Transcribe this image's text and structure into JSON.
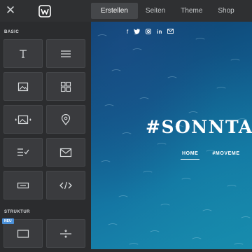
{
  "topbar": {
    "close_icon": "close-icon",
    "logo_icon": "weebly-w-icon",
    "tabs": [
      {
        "label": "Erstellen",
        "active": true
      },
      {
        "label": "Seiten",
        "active": false
      },
      {
        "label": "Theme",
        "active": false
      },
      {
        "label": "Shop",
        "active": false
      }
    ]
  },
  "sidebar": {
    "sections": {
      "basic": "BASIC",
      "struktur": "STRUKTUR"
    },
    "new_badge": "NEU",
    "elements": [
      {
        "icon": "title-icon"
      },
      {
        "icon": "text-icon"
      },
      {
        "icon": "image-icon"
      },
      {
        "icon": "gallery-icon"
      },
      {
        "icon": "slideshow-icon"
      },
      {
        "icon": "map-icon"
      },
      {
        "icon": "form-icon"
      },
      {
        "icon": "email-icon"
      },
      {
        "icon": "button-icon"
      },
      {
        "icon": "embed-code-icon"
      },
      {
        "icon": "section-icon"
      },
      {
        "icon": "divider-icon"
      }
    ]
  },
  "preview": {
    "social_icons": [
      {
        "glyph": "f",
        "name": "facebook-icon"
      },
      {
        "glyph": "🐦",
        "name": "twitter-icon"
      },
      {
        "glyph": "◎",
        "name": "instagram-icon"
      },
      {
        "glyph": "in",
        "name": "linkedin-icon"
      },
      {
        "glyph": "✉",
        "name": "mail-icon"
      }
    ],
    "title": "#SONNTAG",
    "nav": [
      {
        "label": "HOME",
        "active": true
      },
      {
        "label": "#MOVEME",
        "active": false
      }
    ]
  },
  "colors": {
    "sidebar_bg": "#2b2c2e",
    "tile_bg": "#3a3b3e",
    "active_tab_bg": "#45474a",
    "badge": "#4a90d9",
    "water_deep": "#0f3f6e",
    "water_light": "#1a8db0"
  }
}
